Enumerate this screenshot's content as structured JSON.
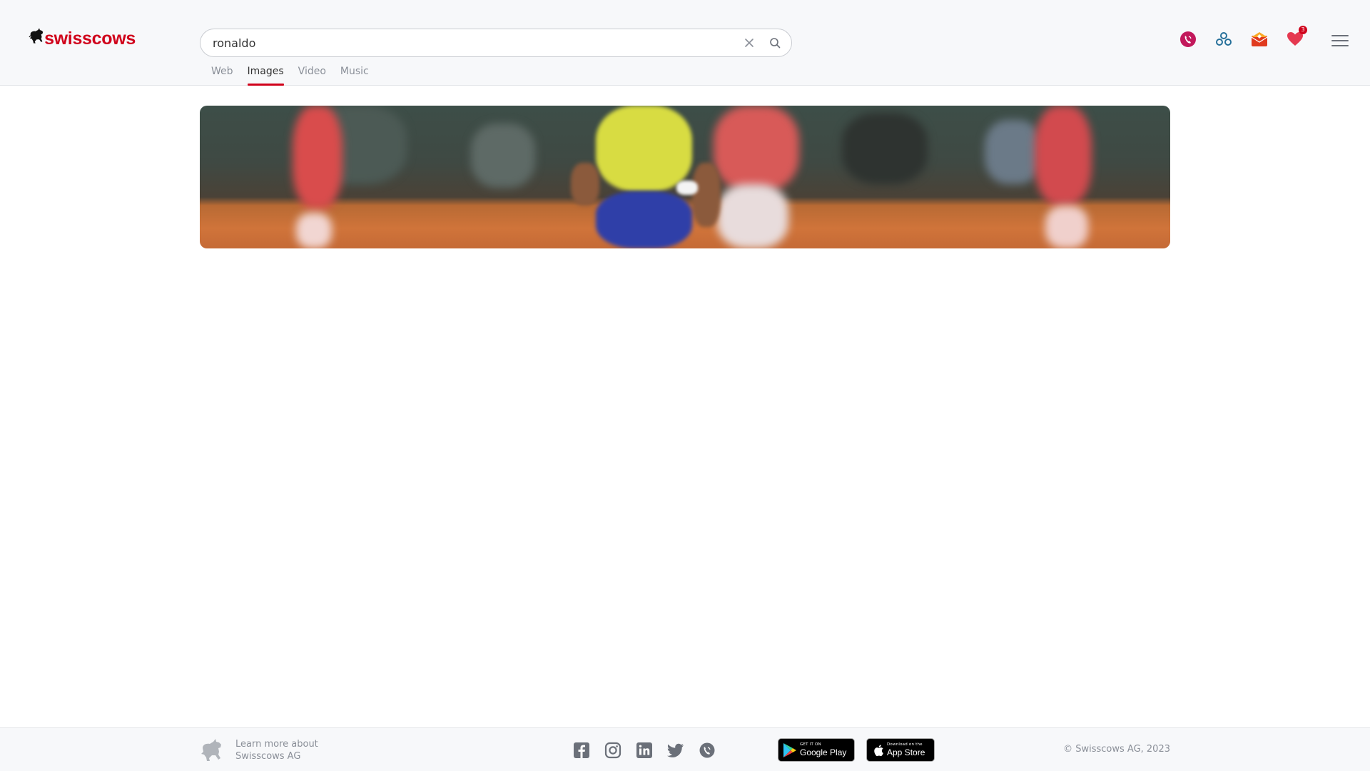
{
  "brand": {
    "name": "swisscows",
    "color": "#d0021b"
  },
  "search": {
    "query": "ronaldo",
    "placeholder": "Search"
  },
  "tabs": [
    {
      "label": "Web",
      "active": false
    },
    {
      "label": "Images",
      "active": true
    },
    {
      "label": "Video",
      "active": false
    },
    {
      "label": "Music",
      "active": false
    }
  ],
  "header_icons": [
    {
      "name": "teleguard-icon",
      "color": "#c2185b"
    },
    {
      "name": "vpn-icon",
      "color": "#26709a"
    },
    {
      "name": "email-icon",
      "color": "#e03a1e"
    },
    {
      "name": "heart-icon",
      "color": "#d0021b",
      "badge": "3"
    }
  ],
  "banner": {
    "image": "football-players-photo"
  },
  "footer": {
    "about_line1": "Learn more about",
    "about_line2": "Swisscows AG",
    "socials": [
      "facebook-icon",
      "instagram-icon",
      "linkedin-icon",
      "twitter-icon",
      "teleguard-icon"
    ],
    "google_play": {
      "small": "GET IT ON",
      "big": "Google Play"
    },
    "app_store": {
      "small": "Download on the",
      "big": "App Store"
    },
    "copyright": "© Swisscows AG, 2023"
  }
}
